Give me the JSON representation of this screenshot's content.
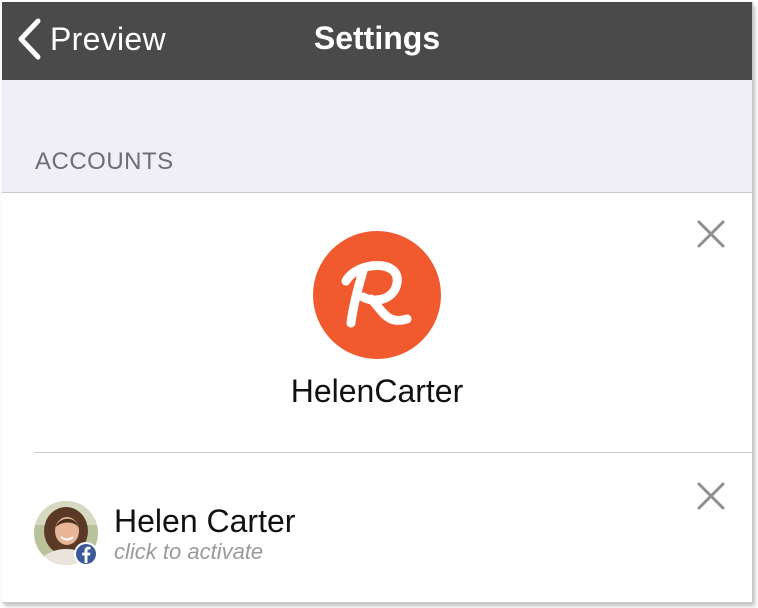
{
  "navbar": {
    "back_label": "Preview",
    "title": "Settings",
    "background": "#4a4a4a"
  },
  "section": {
    "header": "ACCOUNTS"
  },
  "accounts": [
    {
      "service_icon": "runkeeper-logo",
      "brand_color": "#f05a2e",
      "username": "HelenCarter",
      "remove_icon": "close-icon"
    },
    {
      "service_icon": "facebook-icon",
      "name": "Helen Carter",
      "subtitle": "click to activate",
      "remove_icon": "close-icon"
    }
  ]
}
